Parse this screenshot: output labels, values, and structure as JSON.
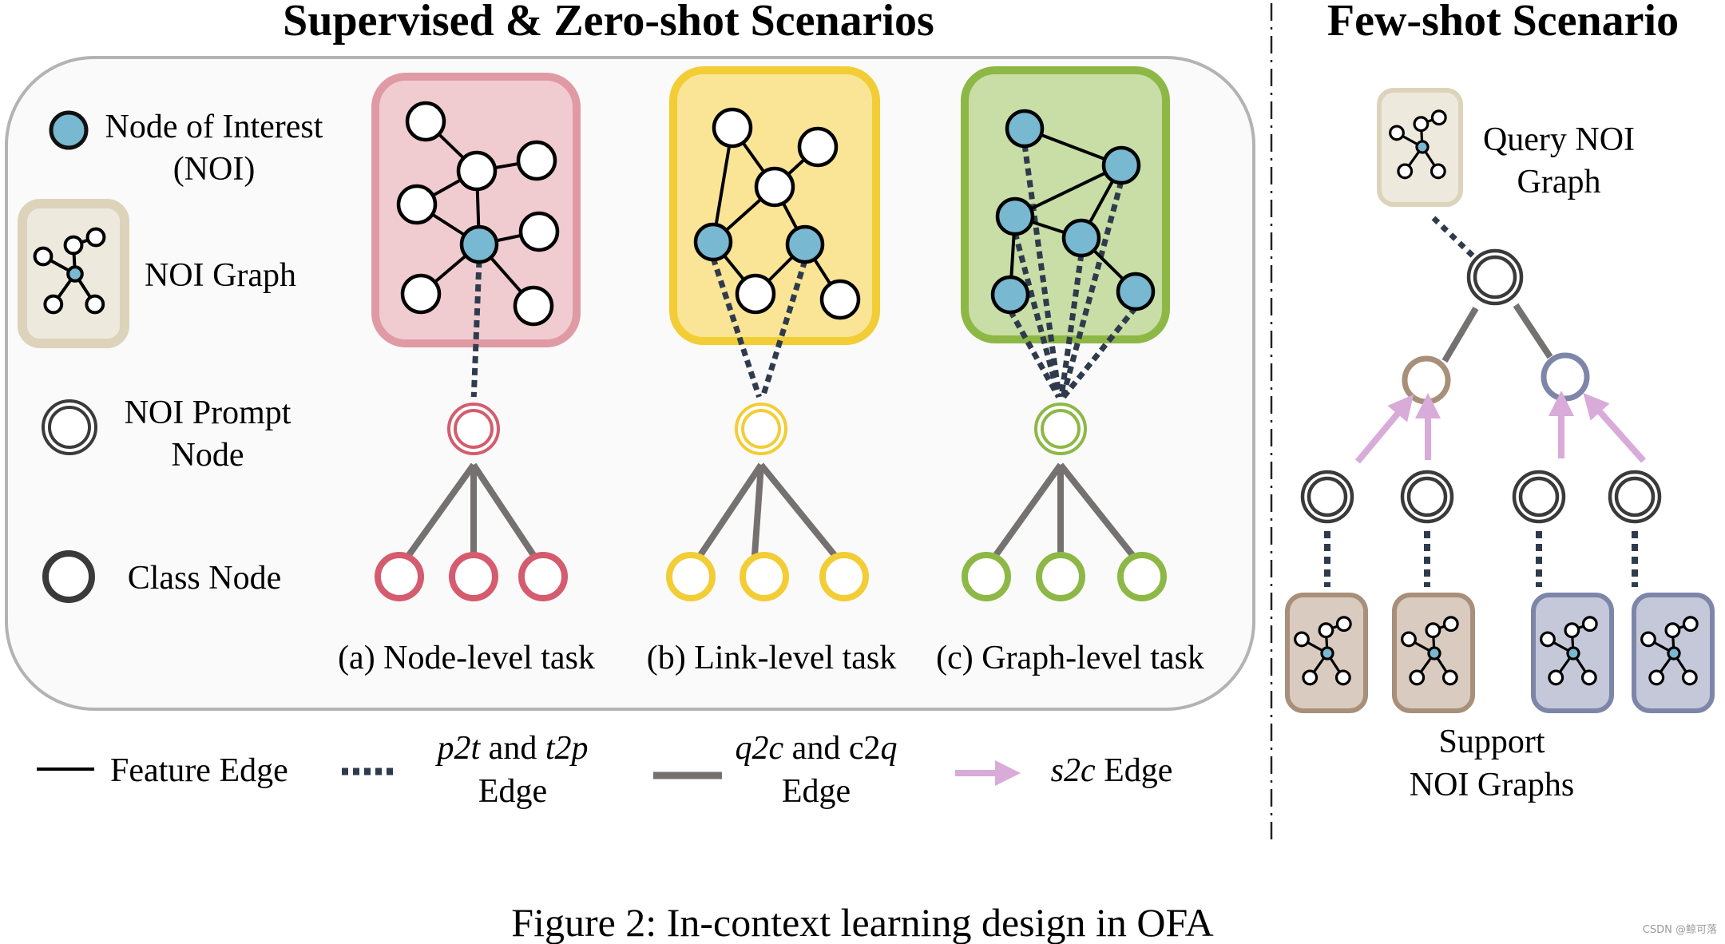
{
  "titles": {
    "left": "Supervised & Zero-shot Scenarios",
    "right": "Few-shot Scenario"
  },
  "legend_left": {
    "noi": [
      "Node of Interest",
      "(NOI)"
    ],
    "noi_graph": "NOI Graph",
    "prompt_node": [
      "NOI Prompt",
      "Node"
    ],
    "class_node": "Class Node"
  },
  "tasks": [
    {
      "label": "(a) Node-level task",
      "color": "#d45c6e",
      "box_fill": "#f0ccd1",
      "box_stroke": "#e09aa4"
    },
    {
      "label": "(b) Link-level task",
      "color": "#f2cd35",
      "box_fill": "#fae597",
      "box_stroke": "#f2cd35"
    },
    {
      "label": "(c) Graph-level task",
      "color": "#8db846",
      "box_fill": "#c8dea6",
      "box_stroke": "#8db846"
    }
  ],
  "few_shot": {
    "query_label": [
      "Query NOI",
      "Graph"
    ],
    "support_label": [
      "Support",
      "NOI Graphs"
    ],
    "class_colors": [
      "#a88f7a",
      "#7d86a8"
    ],
    "support_fills": [
      "#d9cbbf",
      "#c4c8d9"
    ]
  },
  "edge_legend": {
    "feature": "Feature Edge",
    "p2t": {
      "italic1": "p2t",
      "mid": " and ",
      "italic2": "t2p",
      "line2": "Edge"
    },
    "q2c": {
      "italic1": "q2c",
      "mid": " and c2",
      "italic2": "q",
      "line2": "Edge"
    },
    "s2c": {
      "italic": "s2c",
      "rest": " Edge"
    }
  },
  "colors": {
    "noi_fill": "#78b8d0",
    "dotted_edge": "#2f3b4d",
    "qc_edge": "#767171",
    "s2c_arrow": "#d8abd8",
    "noi_graph_fill": "#ede9dd",
    "noi_graph_stroke": "#dcd3ba"
  },
  "caption": "Figure 2: In-context learning design in OFA",
  "watermark": "CSDN @鲸可落"
}
